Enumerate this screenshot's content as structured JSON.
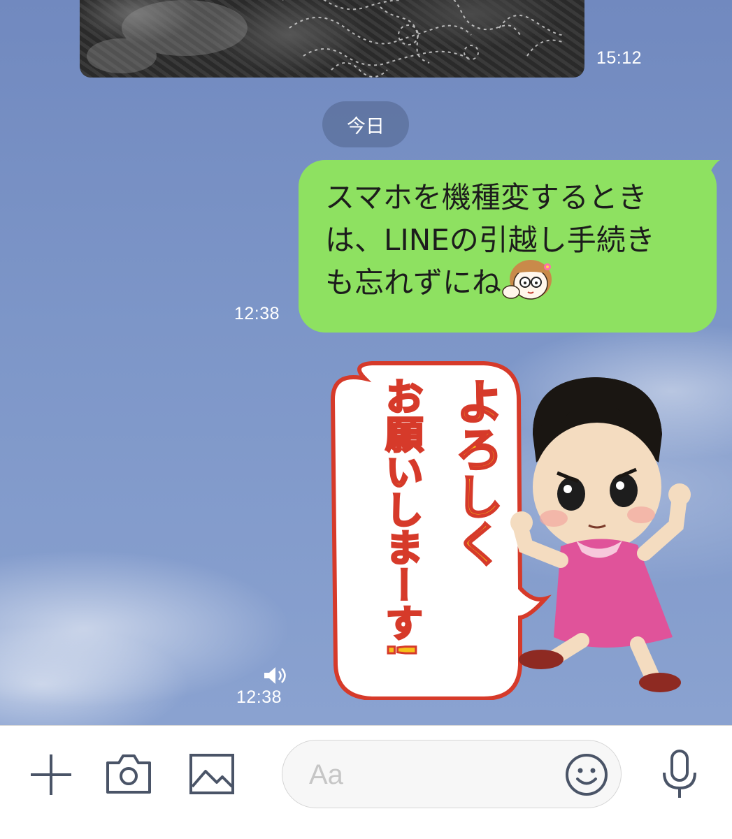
{
  "messages": {
    "photo_time": "15:12",
    "date_separator": "今日",
    "text_message": {
      "line1": "スマホを機種変するとき",
      "line2": "は、LINEの引越し手続き",
      "line3": "も忘れずにね",
      "time": "12:38"
    },
    "sticker": {
      "text_line1": "よろしく",
      "text_line2": "お願いしまーす!",
      "time": "12:38"
    }
  },
  "input_bar": {
    "placeholder": "Aa"
  },
  "colors": {
    "bubble": "#8ee161",
    "background": "#7c95c5",
    "icon": "#4a5467"
  }
}
